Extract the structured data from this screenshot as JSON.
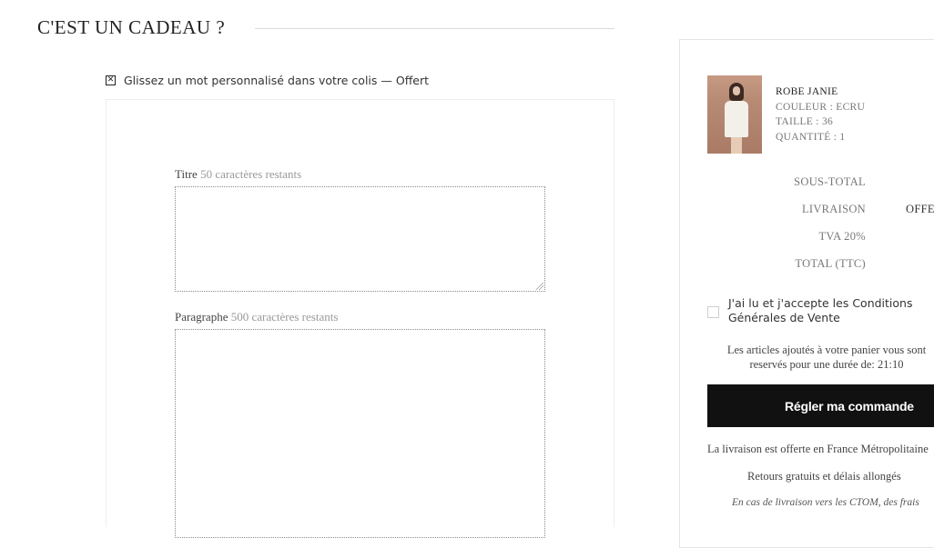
{
  "gift": {
    "heading": "C'EST UN CADEAU ?",
    "checkbox_mark": "✕",
    "option_label": "Glissez un mot personnalisé dans votre colis — Offert",
    "title_field": {
      "label": "Titre",
      "hint": "50 caractères restants",
      "value": ""
    },
    "paragraph_field": {
      "label": "Paragraphe",
      "hint": "500 caractères restants",
      "value": ""
    }
  },
  "summary": {
    "product": {
      "name": "ROBE JANIE",
      "color": "COULEUR : ECRU",
      "size": "TAILLE : 36",
      "quantity": "QUANTITÉ : 1"
    },
    "totals": {
      "subtotal_label": "SOUS-TOTAL",
      "shipping_label": "LIVRAISON",
      "shipping_value": "OFFERT",
      "vat_label": "TVA 20%",
      "total_label": "TOTAL (TTC)"
    },
    "cgv_label": "J'ai lu et j'accepte les Conditions Générales de Vente",
    "reservation_text": "Les articles ajoutés à votre panier vous sont reservés pour une durée de: 21:10",
    "order_button": "Régler ma commande",
    "free_delivery": "La livraison est offerte en France Métropolitaine",
    "returns": "Retours gratuits et délais allongés",
    "ctom_note": "En cas de livraison vers les CTOM, des frais"
  }
}
